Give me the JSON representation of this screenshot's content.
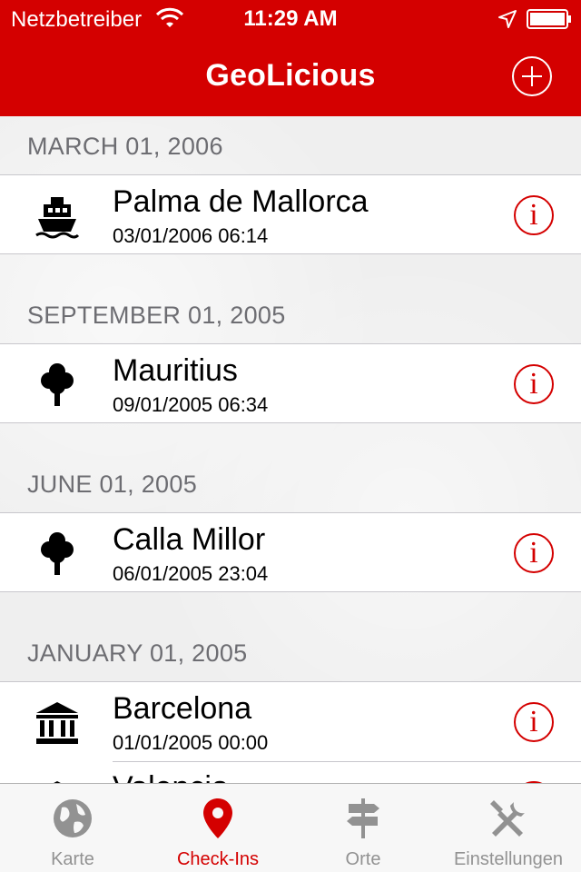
{
  "status_bar": {
    "carrier": "Netzbetreiber",
    "time": "11:29 AM"
  },
  "nav": {
    "title": "GeoLicious",
    "add_icon": "plus-circle-icon"
  },
  "sections": [
    {
      "header": "MARCH 01, 2006",
      "rows": [
        {
          "title": "Palma de Mallorca",
          "subtitle": "03/01/2006 06:14",
          "icon": "ship-icon"
        }
      ]
    },
    {
      "header": "SEPTEMBER 01, 2005",
      "rows": [
        {
          "title": "Mauritius",
          "subtitle": "09/01/2005 06:34",
          "icon": "tree-icon"
        }
      ]
    },
    {
      "header": "JUNE 01, 2005",
      "rows": [
        {
          "title": "Calla Millor",
          "subtitle": "06/01/2005 23:04",
          "icon": "tree-icon"
        }
      ]
    },
    {
      "header": "JANUARY 01, 2005",
      "rows": [
        {
          "title": "Barcelona",
          "subtitle": "01/01/2005 00:00",
          "icon": "museum-icon"
        },
        {
          "title": "Valencia",
          "subtitle": "",
          "icon": "museum-icon"
        }
      ]
    }
  ],
  "tabs": [
    {
      "label": "Karte",
      "icon": "globe-icon",
      "active": false
    },
    {
      "label": "Check-Ins",
      "icon": "map-pin-icon",
      "active": true
    },
    {
      "label": "Orte",
      "icon": "signpost-icon",
      "active": false
    },
    {
      "label": "Einstellungen",
      "icon": "tools-icon",
      "active": false
    }
  ],
  "colors": {
    "accent": "#d40000",
    "tab_inactive": "#929292"
  }
}
